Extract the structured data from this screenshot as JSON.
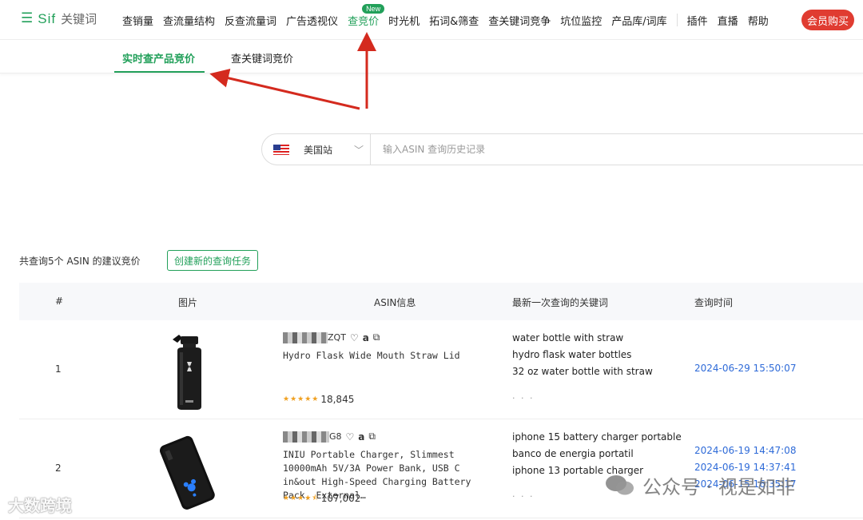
{
  "nav": {
    "logo_icon": "menu-icon",
    "logo_text": "Sif",
    "logo_sub": "关键词",
    "items": [
      {
        "label": "查销量"
      },
      {
        "label": "查流量结构"
      },
      {
        "label": "反查流量词"
      },
      {
        "label": "广告透视仪"
      },
      {
        "label": "查竞价",
        "active": true,
        "badge": "New"
      },
      {
        "label": "时光机"
      },
      {
        "label": "拓词&筛查"
      },
      {
        "label": "查关键词竞争"
      },
      {
        "label": "坑位监控"
      },
      {
        "label": "产品库/词库"
      }
    ],
    "right_items": [
      {
        "label": "插件"
      },
      {
        "label": "直播"
      },
      {
        "label": "帮助"
      }
    ],
    "vip_label": "会员购买",
    "accent_color": "#22a05a",
    "vip_color": "#e03c31"
  },
  "subtabs": [
    {
      "label": "实时查产品竞价",
      "active": true
    },
    {
      "label": "查关键词竞价",
      "active": false
    }
  ],
  "search": {
    "site_label": "美国站",
    "flag_icon": "us-flag-icon",
    "placeholder": "输入ASIN 查询历史记录"
  },
  "summary": {
    "text": "共查询5个 ASIN 的建议竞价",
    "new_task_label": "创建新的查询任务"
  },
  "table": {
    "headers": {
      "index": "#",
      "image": "图片",
      "asin": "ASIN信息",
      "keywords": "最新一次查询的关键词",
      "time": "查询时间"
    },
    "rows": [
      {
        "index": "1",
        "asin_suffix": "ZQT",
        "title": "Hydro Flask Wide Mouth Straw Lid",
        "rating_count": "18,845",
        "rating": 5,
        "keywords": [
          "water bottle with straw",
          "hydro flask water bottles",
          "32 oz water bottle with straw"
        ],
        "more": "· · ·",
        "times": [
          "2024-06-29 15:50:07"
        ]
      },
      {
        "index": "2",
        "asin_suffix": "G8",
        "title": "INIU Portable Charger, Slimmest 10000mAh 5V/3A Power Bank, USB C in&out High-Speed Charging Battery Pack, External…",
        "rating_count": "107,002",
        "rating": 4.5,
        "keywords": [
          "iphone 15 battery charger portable",
          "banco de energia portatil",
          "iphone 13 portable charger"
        ],
        "more": "· · ·",
        "times": [
          "2024-06-19 14:47:08",
          "2024-06-19 14:37:41",
          "2024-06-15 16:35:17"
        ]
      }
    ]
  },
  "watermarks": {
    "left": "大数跨境",
    "right": "公众号 · 视是如非"
  }
}
